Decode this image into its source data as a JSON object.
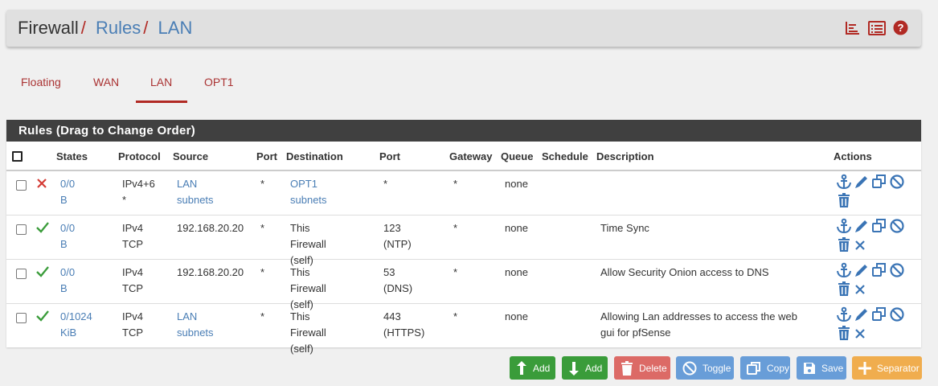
{
  "breadcrumb": {
    "root": "Firewall",
    "rules": "Rules",
    "current": "LAN",
    "sep": "/"
  },
  "header_icons": [
    "chart-bars-icon",
    "log-list-icon",
    "help-icon"
  ],
  "tabs": [
    {
      "label": "Floating",
      "active": false
    },
    {
      "label": "WAN",
      "active": false
    },
    {
      "label": "LAN",
      "active": true
    },
    {
      "label": "OPT1",
      "active": false
    }
  ],
  "panel": {
    "title": "Rules (Drag to Change Order)"
  },
  "columns": {
    "states": "States",
    "protocol": "Protocol",
    "source": "Source",
    "port": "Port",
    "destination": "Destination",
    "dport": "Port",
    "gateway": "Gateway",
    "queue": "Queue",
    "schedule": "Schedule",
    "description": "Description",
    "actions": "Actions"
  },
  "rows": [
    {
      "status": "blocked",
      "states": [
        "0/0 B"
      ],
      "protocol": [
        "IPv4+6 *"
      ],
      "source": "LAN subnets",
      "source_link": true,
      "sport": "*",
      "destination": [
        "OPT1 subnets"
      ],
      "dest_link": true,
      "dport": [
        "*"
      ],
      "gateway": "*",
      "queue": "none",
      "schedule": "",
      "description": [
        ""
      ],
      "delete_rule": false
    },
    {
      "status": "pass",
      "states": [
        "0/0 B"
      ],
      "protocol": [
        "IPv4",
        "TCP"
      ],
      "source": "192.168.20.20",
      "source_link": false,
      "sport": "*",
      "destination": [
        "This Firewall",
        "(self)"
      ],
      "dest_link": false,
      "dport": [
        "123 (NTP)"
      ],
      "gateway": "*",
      "queue": "none",
      "schedule": "",
      "description": [
        "Time Sync"
      ],
      "delete_rule": true
    },
    {
      "status": "pass",
      "states": [
        "0/0 B"
      ],
      "protocol": [
        "IPv4",
        "TCP"
      ],
      "source": "192.168.20.20",
      "source_link": false,
      "sport": "*",
      "destination": [
        "This Firewall",
        "(self)"
      ],
      "dest_link": false,
      "dport": [
        "53 (DNS)"
      ],
      "gateway": "*",
      "queue": "none",
      "schedule": "",
      "description": [
        "Allow Security Onion access to DNS"
      ],
      "delete_rule": true
    },
    {
      "status": "pass",
      "states": [
        "0/1024",
        "KiB"
      ],
      "protocol": [
        "IPv4",
        "TCP"
      ],
      "source": "LAN subnets",
      "source_link": true,
      "sport": "*",
      "destination": [
        "This Firewall",
        "(self)"
      ],
      "dest_link": false,
      "dport": [
        "443",
        "(HTTPS)"
      ],
      "gateway": "*",
      "queue": "none",
      "schedule": "",
      "description": [
        "Allowing Lan addresses to access the web",
        "gui for pfSense"
      ],
      "delete_rule": true
    }
  ],
  "buttons": {
    "add_top": "Add",
    "add_bottom": "Add",
    "delete": "Delete",
    "toggle": "Toggle",
    "copy": "Copy",
    "save": "Save",
    "separator": "Separator"
  },
  "colors": {
    "brand_red": "#b12a24",
    "link_blue": "#4a7eb5",
    "pass_green": "#3a9c3a",
    "block_red": "#d9534f"
  }
}
